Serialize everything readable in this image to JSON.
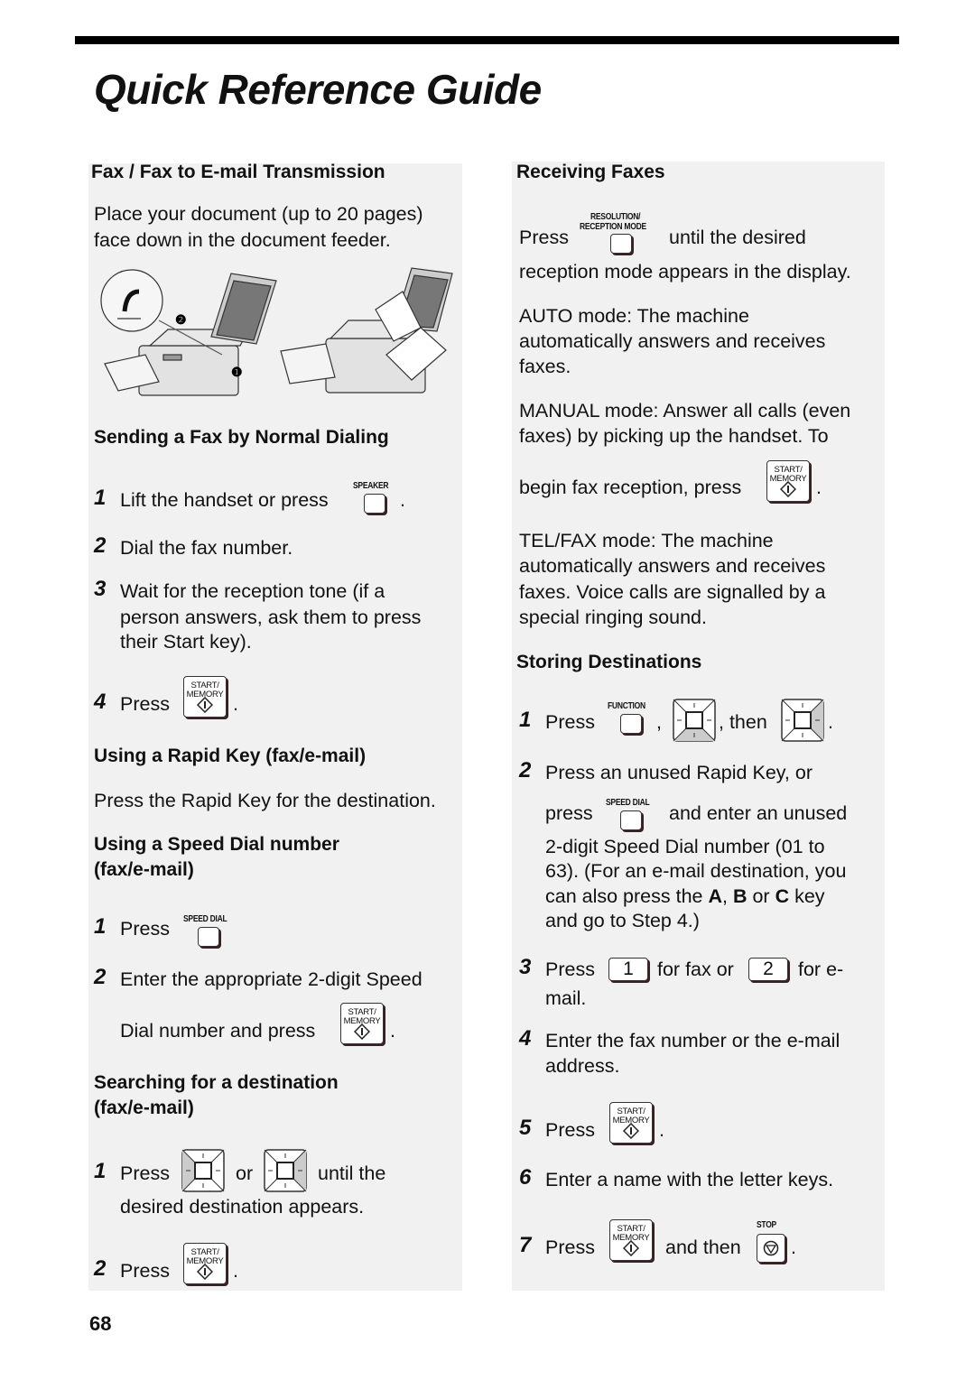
{
  "page": {
    "title": "Quick Reference Guide",
    "page_number": "68"
  },
  "left": {
    "fax_heading": "Fax / Fax to E-mail Transmission",
    "fax_intro_1": "Place your document (up to 20 pages)",
    "fax_intro_2": "face down in the document feeder.",
    "illustration_callouts": [
      "❷",
      "❶"
    ],
    "normal_heading": "Sending a Fax by Normal Dialing",
    "normal_steps": [
      {
        "n": "1",
        "text": "Lift the handset or press",
        "suffix": "."
      },
      {
        "n": "2",
        "text": "Dial the fax number."
      },
      {
        "n": "3",
        "lines": [
          "Wait for the reception tone (if a",
          "person answers, ask them to press",
          "their Start key)."
        ]
      },
      {
        "n": "4",
        "text": "Press",
        "suffix": "."
      }
    ],
    "rapid_heading": "Using a Rapid Key (fax/e-mail)",
    "rapid_text": "Press the Rapid Key for the destination.",
    "speed_heading_1": "Using a Speed Dial number",
    "speed_heading_2": "(fax/e-mail)",
    "speed_steps": [
      {
        "n": "1",
        "text": "Press"
      },
      {
        "n": "2",
        "line1": "Enter the appropriate 2-digit Speed",
        "line2": "Dial number and press",
        "suffix": "."
      }
    ],
    "search_heading_1": "Searching for a destination",
    "search_heading_2": "(fax/e-mail)",
    "search_steps": [
      {
        "n": "1",
        "text": "Press",
        "or": "or",
        "until": "until the",
        "line2": "desired destination appears."
      },
      {
        "n": "2",
        "text": "Press",
        "suffix": "."
      }
    ]
  },
  "right": {
    "receiving_heading": "Receiving Faxes",
    "recv_press": "Press",
    "recv_until": "until the desired",
    "recv_line2": "reception mode appears in the display.",
    "auto_lines": [
      "AUTO mode: The machine",
      "automatically answers and receives",
      "faxes."
    ],
    "manual_lines": [
      "MANUAL mode: Answer all calls (even",
      "faxes) by picking up the handset. To"
    ],
    "manual_begin": "begin fax reception, press",
    "manual_suffix": ".",
    "telfax_lines": [
      "TEL/FAX mode: The machine",
      "automatically answers and receives",
      "faxes. Voice calls are signalled by a",
      "special ringing sound."
    ],
    "storing_heading": "Storing Destinations",
    "storing_steps": {
      "s1": {
        "n": "1",
        "press": "Press",
        "comma": ",",
        "then": ", then",
        "suffix": "."
      },
      "s2": {
        "n": "2",
        "line1": "Press an unused Rapid Key, or",
        "press": "press",
        "after": "and enter an unused",
        "lines": [
          "2-digit Speed Dial number (01 to",
          "63). (For an e-mail destination, you"
        ],
        "line_key_pre": "can also press the ",
        "key_a": "A",
        "sep1": ", ",
        "key_b": "B",
        "sep2": " or ",
        "key_c": "C",
        "line_key_post": " key",
        "last": "and go to Step 4.)"
      },
      "s3": {
        "n": "3",
        "press": "Press",
        "key1": "1",
        "mid": "for fax or",
        "key2": "2",
        "after": "for e-",
        "line2": "mail."
      },
      "s4": {
        "n": "4",
        "line1": "Enter the fax number or the e-mail",
        "line2": "address."
      },
      "s5": {
        "n": "5",
        "press": "Press",
        "suffix": "."
      },
      "s6": {
        "n": "6",
        "text": "Enter a name with the letter keys."
      },
      "s7": {
        "n": "7",
        "press": "Press",
        "and_then": "and then",
        "suffix": "."
      }
    }
  },
  "keys": {
    "speaker": "SPEAKER",
    "start_line1": "START/",
    "start_line2": "MEMORY",
    "speed_dial": "SPEED DIAL",
    "resolution_line1": "RESOLUTION/",
    "resolution_line2": "RECEPTION MODE",
    "function": "FUNCTION",
    "stop": "STOP"
  }
}
